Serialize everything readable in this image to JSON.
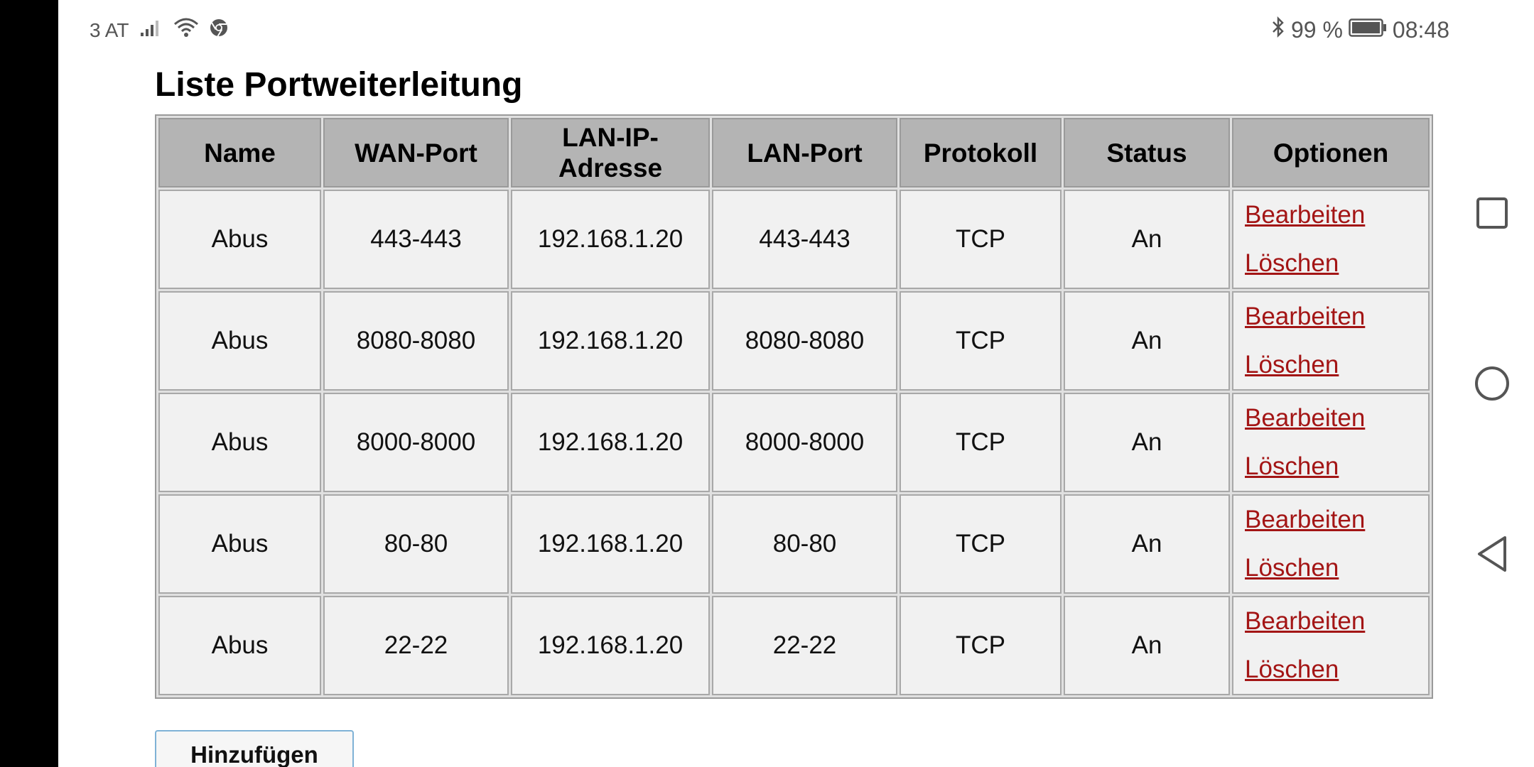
{
  "status_bar": {
    "carrier": "3 AT",
    "battery": "99 %",
    "time": "08:48"
  },
  "page": {
    "title": "Liste Portweiterleitung"
  },
  "table": {
    "headers": [
      "Name",
      "WAN-Port",
      "LAN-IP-Adresse",
      "LAN-Port",
      "Protokoll",
      "Status",
      "Optionen"
    ],
    "header_lan_ip_line1": "LAN-IP-",
    "header_lan_ip_line2": "Adresse",
    "rows": [
      {
        "name": "Abus",
        "wan_port": "443-443",
        "lan_ip": "192.168.1.20",
        "lan_port": "443-443",
        "protocol": "TCP",
        "status": "An",
        "edit": "Bearbeiten",
        "delete": "Löschen"
      },
      {
        "name": "Abus",
        "wan_port": "8080-8080",
        "lan_ip": "192.168.1.20",
        "lan_port": "8080-8080",
        "protocol": "TCP",
        "status": "An",
        "edit": "Bearbeiten",
        "delete": "Löschen"
      },
      {
        "name": "Abus",
        "wan_port": "8000-8000",
        "lan_ip": "192.168.1.20",
        "lan_port": "8000-8000",
        "protocol": "TCP",
        "status": "An",
        "edit": "Bearbeiten",
        "delete": "Löschen"
      },
      {
        "name": "Abus",
        "wan_port": "80-80",
        "lan_ip": "192.168.1.20",
        "lan_port": "80-80",
        "protocol": "TCP",
        "status": "An",
        "edit": "Bearbeiten",
        "delete": "Löschen"
      },
      {
        "name": "Abus",
        "wan_port": "22-22",
        "lan_ip": "192.168.1.20",
        "lan_port": "22-22",
        "protocol": "TCP",
        "status": "An",
        "edit": "Bearbeiten",
        "delete": "Löschen"
      }
    ]
  },
  "actions": {
    "add_label": "Hinzufügen"
  },
  "icons": {
    "signal": "signal-icon",
    "wifi": "wifi-icon",
    "chrome": "chrome-icon",
    "bluetooth": "bluetooth-icon",
    "battery": "battery-icon",
    "nav_recent": "square-icon",
    "nav_home": "circle-icon",
    "nav_back": "triangle-back-icon"
  },
  "colors": {
    "link": "#a31515",
    "header_bg": "#b4b4b4",
    "cell_bg": "#f1f1f1"
  }
}
